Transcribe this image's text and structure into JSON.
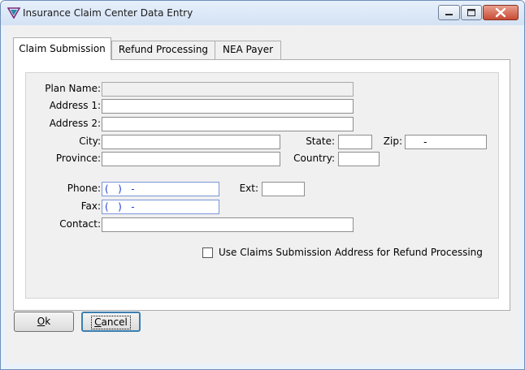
{
  "window": {
    "title": "Insurance Claim Center Data Entry"
  },
  "tabs": [
    {
      "label": "Claim Submission",
      "active": true
    },
    {
      "label": "Refund Processing",
      "active": false
    },
    {
      "label": "NEA Payer",
      "active": false
    }
  ],
  "form": {
    "plan_name_label": "Plan Name:",
    "address1_label": "Address 1:",
    "address2_label": "Address 2:",
    "city_label": "City:",
    "state_label": "State:",
    "zip_label": "Zip:",
    "zip_value": "     -",
    "province_label": "Province:",
    "country_label": "Country:",
    "phone_label": "Phone:",
    "phone_value": "(   )   -",
    "ext_label": "Ext:",
    "fax_label": "Fax:",
    "fax_value": "(   )   -",
    "contact_label": "Contact:",
    "use_address_label": "Use Claims Submission Address for Refund Processing",
    "use_address_checked": false
  },
  "buttons": {
    "ok_accel": "O",
    "ok_rest": "k",
    "cancel_accel": "C",
    "cancel_rest": "ancel"
  },
  "colors": {
    "title_bar": "#dbe7f6",
    "close_button": "#c84b34",
    "mask_text": "#1d3ed6",
    "default_button_border": "#3c7fb1"
  }
}
